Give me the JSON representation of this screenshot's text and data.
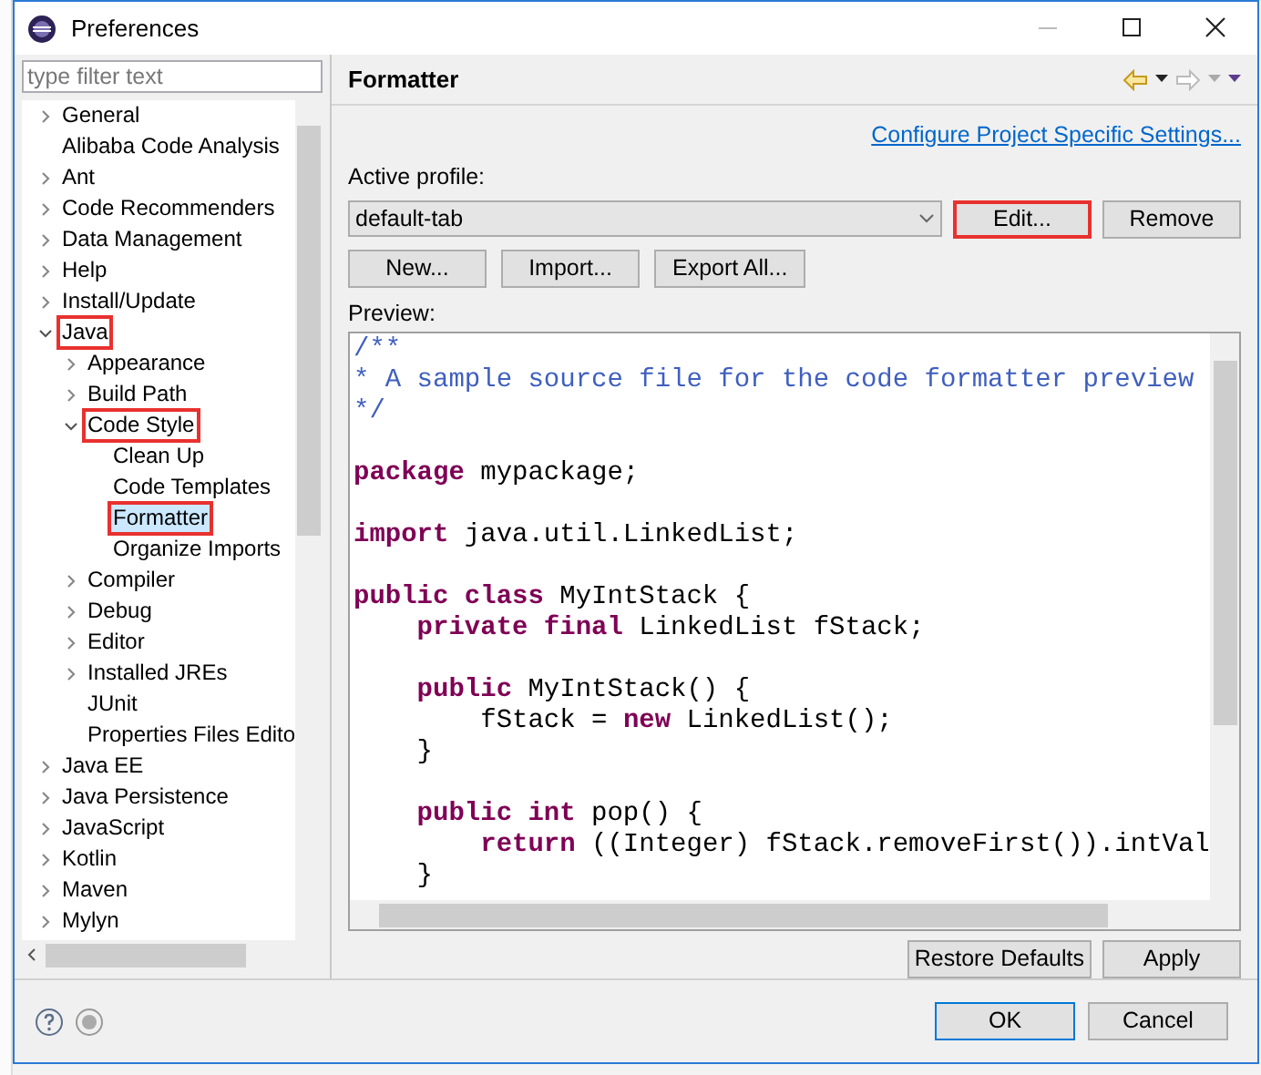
{
  "window": {
    "title": "Preferences"
  },
  "filter": {
    "placeholder": "type filter text"
  },
  "tree": [
    {
      "label": "General",
      "expanded": false,
      "selected": false,
      "marked": false
    },
    {
      "label": "Alibaba Code Analysis",
      "selected": false,
      "marked": false
    },
    {
      "label": "Ant",
      "expanded": false,
      "selected": false,
      "marked": false
    },
    {
      "label": "Code Recommenders",
      "expanded": false,
      "selected": false,
      "marked": false
    },
    {
      "label": "Data Management",
      "expanded": false,
      "selected": false,
      "marked": false
    },
    {
      "label": "Help",
      "expanded": false,
      "selected": false,
      "marked": false
    },
    {
      "label": "Install/Update",
      "expanded": false,
      "selected": false,
      "marked": false
    },
    {
      "label": "Java",
      "expanded": true,
      "selected": false,
      "marked": true,
      "children": [
        {
          "label": "Appearance",
          "expanded": false,
          "selected": false,
          "marked": false
        },
        {
          "label": "Build Path",
          "expanded": false,
          "selected": false,
          "marked": false
        },
        {
          "label": "Code Style",
          "expanded": true,
          "selected": false,
          "marked": true,
          "children": [
            {
              "label": "Clean Up",
              "selected": false,
              "marked": false
            },
            {
              "label": "Code Templates",
              "selected": false,
              "marked": false
            },
            {
              "label": "Formatter",
              "selected": true,
              "marked": true
            },
            {
              "label": "Organize Imports",
              "selected": false,
              "marked": false
            }
          ]
        },
        {
          "label": "Compiler",
          "expanded": false,
          "selected": false,
          "marked": false
        },
        {
          "label": "Debug",
          "expanded": false,
          "selected": false,
          "marked": false
        },
        {
          "label": "Editor",
          "expanded": false,
          "selected": false,
          "marked": false
        },
        {
          "label": "Installed JREs",
          "expanded": false,
          "selected": false,
          "marked": false
        },
        {
          "label": "JUnit",
          "selected": false,
          "marked": false
        },
        {
          "label": "Properties Files Edito",
          "selected": false,
          "marked": false
        }
      ]
    },
    {
      "label": "Java EE",
      "expanded": false,
      "selected": false,
      "marked": false
    },
    {
      "label": "Java Persistence",
      "expanded": false,
      "selected": false,
      "marked": false
    },
    {
      "label": "JavaScript",
      "expanded": false,
      "selected": false,
      "marked": false
    },
    {
      "label": "Kotlin",
      "expanded": false,
      "selected": false,
      "marked": false
    },
    {
      "label": "Maven",
      "expanded": false,
      "selected": false,
      "marked": false
    },
    {
      "label": "Mylyn",
      "expanded": false,
      "selected": false,
      "marked": false
    }
  ],
  "page": {
    "title": "Formatter",
    "link": "Configure Project Specific Settings...",
    "profile_label": "Active profile:",
    "profile_value": "default-tab",
    "profile_buttons": [
      {
        "label": "Edit...",
        "marked": true
      },
      {
        "label": "Remove",
        "marked": false
      }
    ],
    "buttons": [
      "New...",
      "Import...",
      "Export All..."
    ],
    "preview_label": "Preview:",
    "preview": [
      [
        [
          {
            "kind": "comment",
            "text": "/**"
          }
        ],
        [
          {
            "kind": "comment",
            "text": "* A sample source file for the code formatter preview"
          }
        ],
        [
          {
            "kind": "comment",
            "text": "*/"
          }
        ]
      ],
      [
        [
          {
            "kind": "keyword",
            "text": "package"
          },
          {
            "kind": "plain",
            "text": " mypackage;"
          }
        ]
      ],
      [
        [
          {
            "kind": "keyword",
            "text": "import"
          },
          {
            "kind": "plain",
            "text": " java.util.LinkedList;"
          }
        ]
      ],
      [
        [
          {
            "kind": "keyword",
            "text": "public class"
          },
          {
            "kind": "plain",
            "text": " MyIntStack {"
          }
        ],
        [
          {
            "kind": "keyword",
            "text": "    private final"
          },
          {
            "kind": "plain",
            "text": " LinkedList fStack;"
          }
        ]
      ],
      [
        [
          {
            "kind": "keyword",
            "text": "    public"
          },
          {
            "kind": "plain",
            "text": " MyIntStack() {"
          }
        ],
        [
          {
            "kind": "plain",
            "text": "        fStack = "
          },
          {
            "kind": "keyword",
            "text": "new"
          },
          {
            "kind": "plain",
            "text": " LinkedList();"
          }
        ],
        [
          {
            "kind": "plain",
            "text": "    }"
          }
        ]
      ],
      [
        [
          {
            "kind": "keyword",
            "text": "    public int"
          },
          {
            "kind": "plain",
            "text": " pop() {"
          }
        ],
        [
          {
            "kind": "keyword",
            "text": "        return"
          },
          {
            "kind": "plain",
            "text": " ((Integer) fStack.removeFirst()).intVal"
          }
        ],
        [
          {
            "kind": "plain",
            "text": "    }"
          }
        ]
      ]
    ],
    "page_buttons": [
      "Restore Defaults",
      "Apply"
    ]
  },
  "dialog_buttons": [
    {
      "label": "OK",
      "default": true
    },
    {
      "label": "Cancel",
      "default": false
    }
  ]
}
